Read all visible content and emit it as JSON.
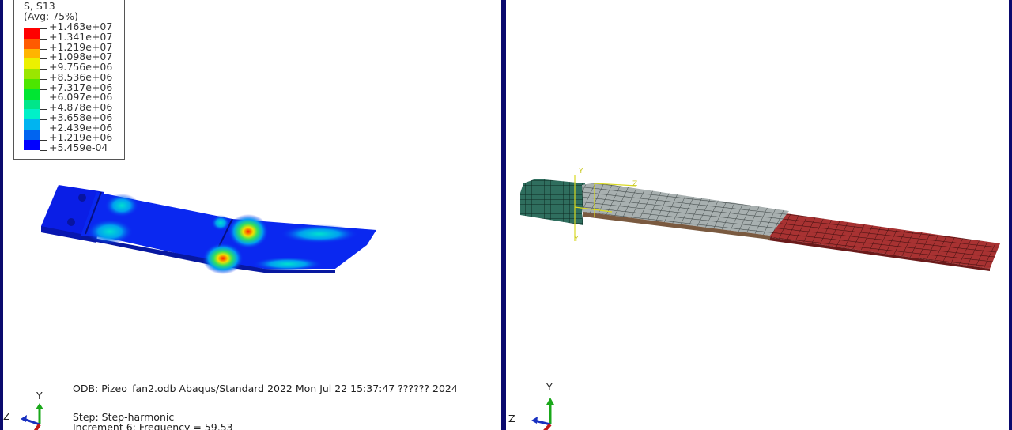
{
  "legend": {
    "title": "S, S13",
    "avg": "(Avg: 75%)",
    "values": [
      "+1.463e+07",
      "+1.341e+07",
      "+1.219e+07",
      "+1.098e+07",
      "+9.756e+06",
      "+8.536e+06",
      "+7.317e+06",
      "+6.097e+06",
      "+4.878e+06",
      "+3.658e+06",
      "+2.439e+06",
      "+1.219e+06",
      "+5.459e-04"
    ],
    "colors": [
      "#ff0000",
      "#ff5a00",
      "#ffb400",
      "#ecf000",
      "#9ae600",
      "#4ce600",
      "#00e632",
      "#00e68a",
      "#00f0c8",
      "#00b4f0",
      "#0064f0",
      "#0000ff"
    ]
  },
  "info": {
    "odb": "ODB: Pizeo_fan2.odb    Abaqus/Standard 2022    Mon Jul 22 15:37:47 ?????? 2024",
    "step": "Step: Step-harmonic",
    "increment": "Increment      6: Frequency =    59.53"
  },
  "triad_left": {
    "y": "Y",
    "z": "Z"
  },
  "triad_right": {
    "y": "Y",
    "z": "Z"
  },
  "csys": {
    "y1": "Y",
    "z": "Z",
    "y2": "Y"
  },
  "colors": {
    "frame": "#0a0a6e",
    "base_part": "#2f6e5e",
    "piezo_part": "#a8b0b0",
    "beam_part": "#a83232"
  }
}
